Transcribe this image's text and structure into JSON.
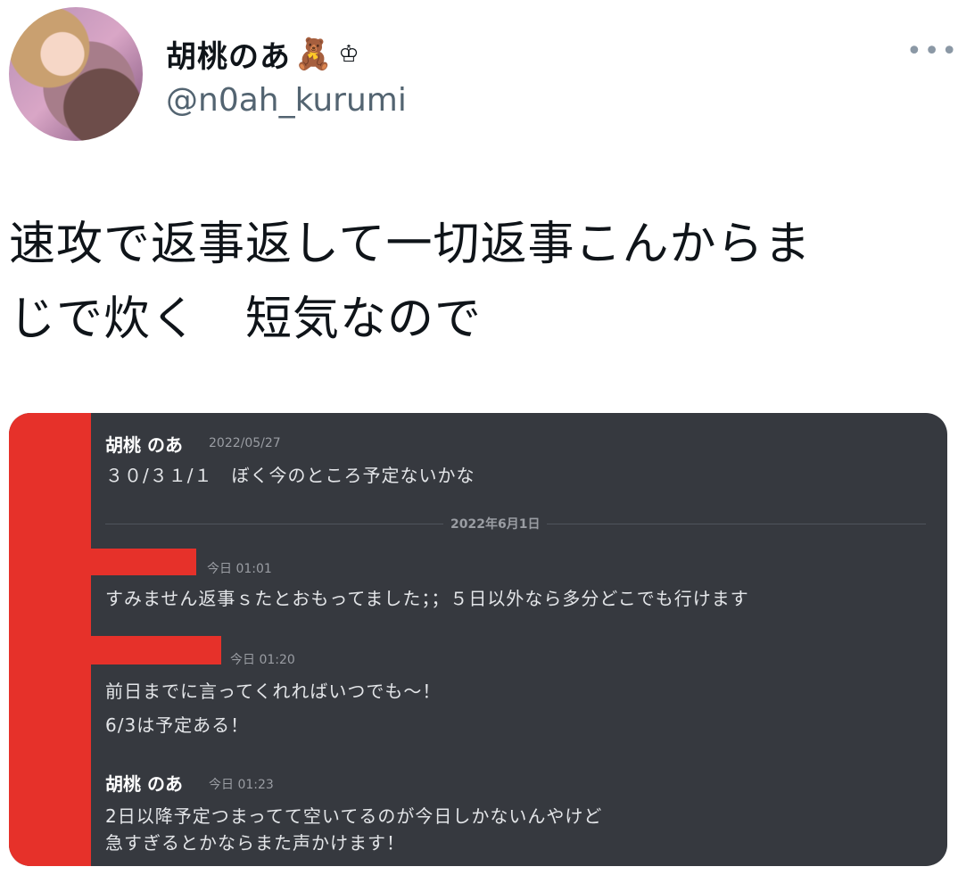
{
  "profile": {
    "display_name": "胡桃のあ",
    "bear_emoji": "🧸",
    "crown_symbol": "♔",
    "handle": "@n0ah_kurumi",
    "more_icon": "•••"
  },
  "tweet": {
    "line1": "速攻で返事返して一切返事こんからま",
    "line2": "じで炊く　短気なので"
  },
  "chat": {
    "msg1": {
      "author": "胡桃 のあ",
      "time": "2022/05/27",
      "text": "３０/３１/１　ぼく今のところ予定ないかな"
    },
    "date_divider": "2022年6月1日",
    "msg2": {
      "time": "今日 01:01",
      "text": "すみません返事ｓたとおもってました；；５日以外なら多分どこでも行けます"
    },
    "msg3": {
      "time": "今日 01:20",
      "text1": "前日までに言ってくれればいつでも～！",
      "text2": "6/3は予定ある！"
    },
    "msg4": {
      "author": "胡桃 のあ",
      "time": "今日 01:23",
      "text1": "2日以降予定つまってて空いてるのが今日しかないんやけど",
      "text2": "急すぎるとかならまた声かけます！"
    }
  },
  "colors": {
    "redaction": "#e6312a",
    "chat_bg": "#36393f"
  }
}
